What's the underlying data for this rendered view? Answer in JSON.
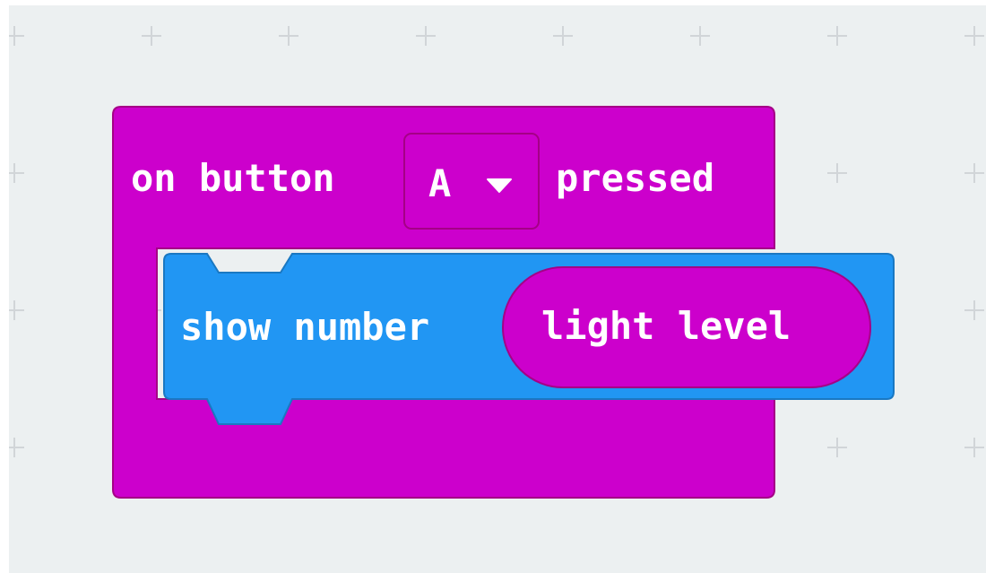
{
  "workspace": {
    "background_color": "#ecf0f1",
    "grid_mark_color": "#d1d5d8"
  },
  "event_block": {
    "prefix_label": "on button",
    "button_dropdown": {
      "selected_value": "A",
      "icon": "caret-down-icon"
    },
    "suffix_label": "pressed",
    "color": "#cc00cc"
  },
  "statement_block": {
    "label": "show number",
    "color": "#2196f3",
    "argument": {
      "label": "light level",
      "color": "#cc00cc"
    }
  }
}
